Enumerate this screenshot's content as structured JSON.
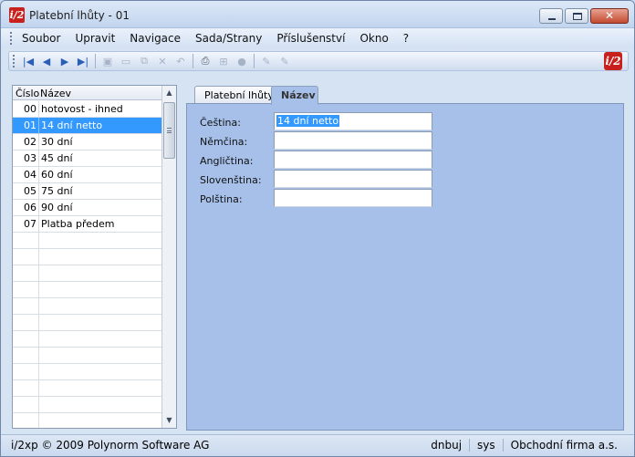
{
  "window": {
    "title": "Platební lhůty - 01",
    "logo_text": "i/2"
  },
  "menu": [
    "Soubor",
    "Upravit",
    "Navigace",
    "Sada/Strany",
    "Příslušenství",
    "Okno",
    "?"
  ],
  "toolbar": {
    "buttons": [
      {
        "icon": "first-record-icon",
        "glyph": "|◀"
      },
      {
        "icon": "previous-record-icon",
        "glyph": "◀"
      },
      {
        "icon": "next-record-icon",
        "glyph": "▶"
      },
      {
        "icon": "last-record-icon",
        "glyph": "▶|"
      },
      {
        "icon": "save-icon",
        "glyph": "▣"
      },
      {
        "icon": "new-icon",
        "glyph": "▭"
      },
      {
        "icon": "copy-icon",
        "glyph": "⧉"
      },
      {
        "icon": "delete-icon",
        "glyph": "✕"
      },
      {
        "icon": "undo-icon",
        "glyph": "↶"
      },
      {
        "icon": "print-icon",
        "glyph": "⎙"
      },
      {
        "icon": "tree-icon",
        "glyph": "⊞"
      },
      {
        "icon": "lock-icon",
        "glyph": "●"
      },
      {
        "icon": "edit-icon",
        "glyph": "✎"
      },
      {
        "icon": "edit-alt-icon",
        "glyph": "✎"
      }
    ]
  },
  "grid": {
    "columns": {
      "number": "Číslo",
      "name": "Název"
    },
    "rows": [
      {
        "number": "00",
        "name": "hotovost - ihned"
      },
      {
        "number": "01",
        "name": "14 dní netto",
        "selected": true
      },
      {
        "number": "02",
        "name": "30 dní"
      },
      {
        "number": "03",
        "name": "45 dní"
      },
      {
        "number": "04",
        "name": "60 dní"
      },
      {
        "number": "05",
        "name": "75 dní"
      },
      {
        "number": "06",
        "name": "90 dní"
      },
      {
        "number": "07",
        "name": "Platba předem"
      }
    ],
    "empty_rows": 12
  },
  "tabs": [
    {
      "label": "Platební lhůty",
      "active": false
    },
    {
      "label": "Název",
      "active": true
    }
  ],
  "form": {
    "fields": [
      {
        "label": "Čeština:",
        "value": "14 dní netto"
      },
      {
        "label": "Němčina:",
        "value": ""
      },
      {
        "label": "Angličtina:",
        "value": ""
      },
      {
        "label": "Slovenština:",
        "value": ""
      },
      {
        "label": "Polština:",
        "value": ""
      }
    ]
  },
  "status": {
    "copyright": "i/2xp © 2009 Polynorm Software AG",
    "user": "dnbuj",
    "system": "sys",
    "company": "Obchodní firma a.s."
  },
  "colors": {
    "panel": "#a6c0ea",
    "selection": "#3399ff",
    "brand": "#c8201c"
  }
}
